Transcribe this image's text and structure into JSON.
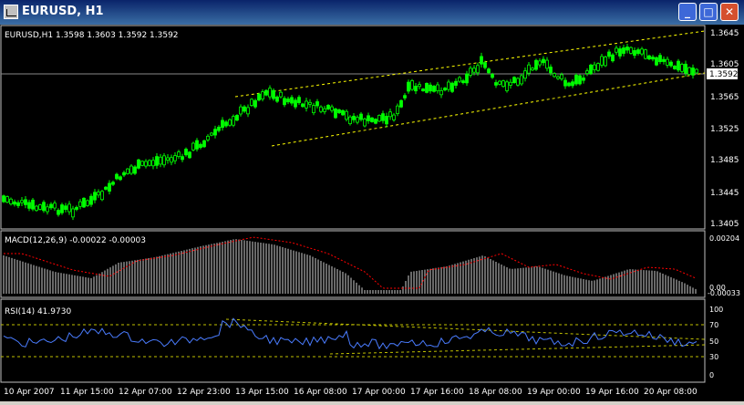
{
  "window": {
    "title": "EURUSD, H1",
    "buttons": {
      "minimize": "_",
      "maximize": "□",
      "close": "✕"
    }
  },
  "chart_data": [
    {
      "type": "candlestick",
      "title": "EURUSD,H1  1.3598 1.3603 1.3592 1.3592",
      "price_axis_labels": [
        "1.3645",
        "1.3605",
        "1.3565",
        "1.3525",
        "1.3485",
        "1.3445",
        "1.3405"
      ],
      "current_price": "1.3592",
      "ylim": [
        1.3395,
        1.365
      ],
      "trend_channel": {
        "upper": [
          [
            1.357,
            1.3645
          ]
        ],
        "lower": [
          [
            1.35,
            1.3585
          ]
        ]
      },
      "colors": {
        "bull": "#00ff00",
        "bear": "#00ff00",
        "channel": "#ffff00"
      }
    },
    {
      "type": "bar",
      "title": "MACD(12,26,9) -0.00022 -0.00003",
      "axis_labels": [
        "0.00204",
        "0.00",
        "-0.00033"
      ],
      "ylim": [
        -0.00033,
        0.00204
      ]
    },
    {
      "type": "line",
      "title": "RSI(14) 41.9730",
      "axis_labels": [
        "100",
        "70",
        "50",
        "30",
        "0"
      ],
      "levels": [
        70,
        30
      ],
      "ylim": [
        0,
        100
      ]
    }
  ],
  "time_axis": [
    "10 Apr 2007",
    "11 Apr 15:00",
    "12 Apr 07:00",
    "12 Apr 23:00",
    "13 Apr 15:00",
    "16 Apr 08:00",
    "17 Apr 00:00",
    "17 Apr 16:00",
    "18 Apr 08:00",
    "19 Apr 00:00",
    "19 Apr 16:00",
    "20 Apr 08:00"
  ]
}
